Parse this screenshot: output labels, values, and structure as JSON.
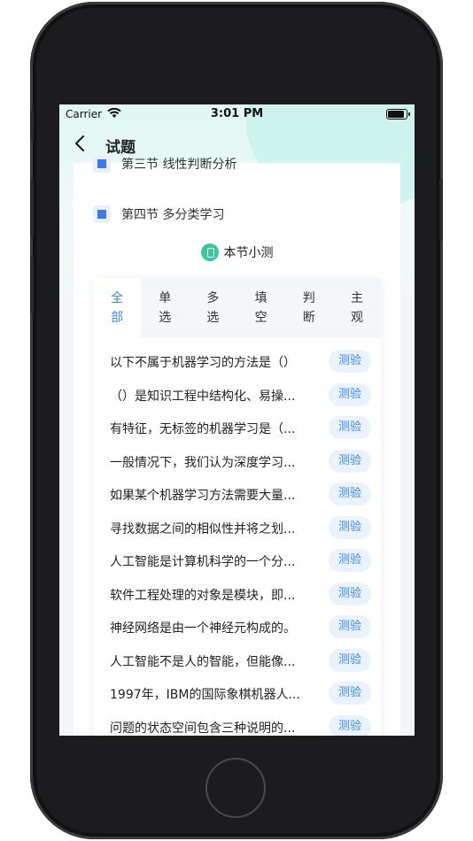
{
  "status": {
    "carrier": "Carrier",
    "time": "3:01 PM",
    "battery_level": 1.0
  },
  "nav": {
    "title": "试题",
    "back_icon": "chevron-left-icon"
  },
  "sections": [
    {
      "label": "第三节 线性判断分析"
    },
    {
      "label": "第四节 多分类学习"
    }
  ],
  "quiz": {
    "title": "本节小测",
    "icon": "quiz-icon"
  },
  "tabs": [
    {
      "label": "全部",
      "active": true
    },
    {
      "label": "单选",
      "active": false
    },
    {
      "label": "多选",
      "active": false
    },
    {
      "label": "填空",
      "active": false
    },
    {
      "label": "判断",
      "active": false
    },
    {
      "label": "主观",
      "active": false
    }
  ],
  "questions": [
    {
      "text": "以下不属于机器学习的方法是（）",
      "action": "测验"
    },
    {
      "text": "（）是知识工程中结构化、易操...",
      "action": "测验"
    },
    {
      "text": "有特征，无标签的机器学习是（...",
      "action": "测验"
    },
    {
      "text": "一般情况下，我们认为深度学习...",
      "action": "测验"
    },
    {
      "text": "如果某个机器学习方法需要大量...",
      "action": "测验"
    },
    {
      "text": "寻找数据之间的相似性并将之划...",
      "action": "测验"
    },
    {
      "text": "人工智能是计算机科学的一个分...",
      "action": "测验"
    },
    {
      "text": "软件工程处理的对象是模块，即...",
      "action": "测验"
    },
    {
      "text": "神经网络是由一个神经元构成的。",
      "action": "测验"
    },
    {
      "text": "人工智能不是人的智能，但能像...",
      "action": "测验"
    },
    {
      "text": "1997年，IBM的国际象棋机器人...",
      "action": "测验"
    },
    {
      "text": "问题的状态空间包含三种说明的...",
      "action": "测验"
    }
  ],
  "colors": {
    "accent": "#3a8bf0",
    "quiz_icon": "#35c99b",
    "section_marker": "#3b7bf0"
  }
}
